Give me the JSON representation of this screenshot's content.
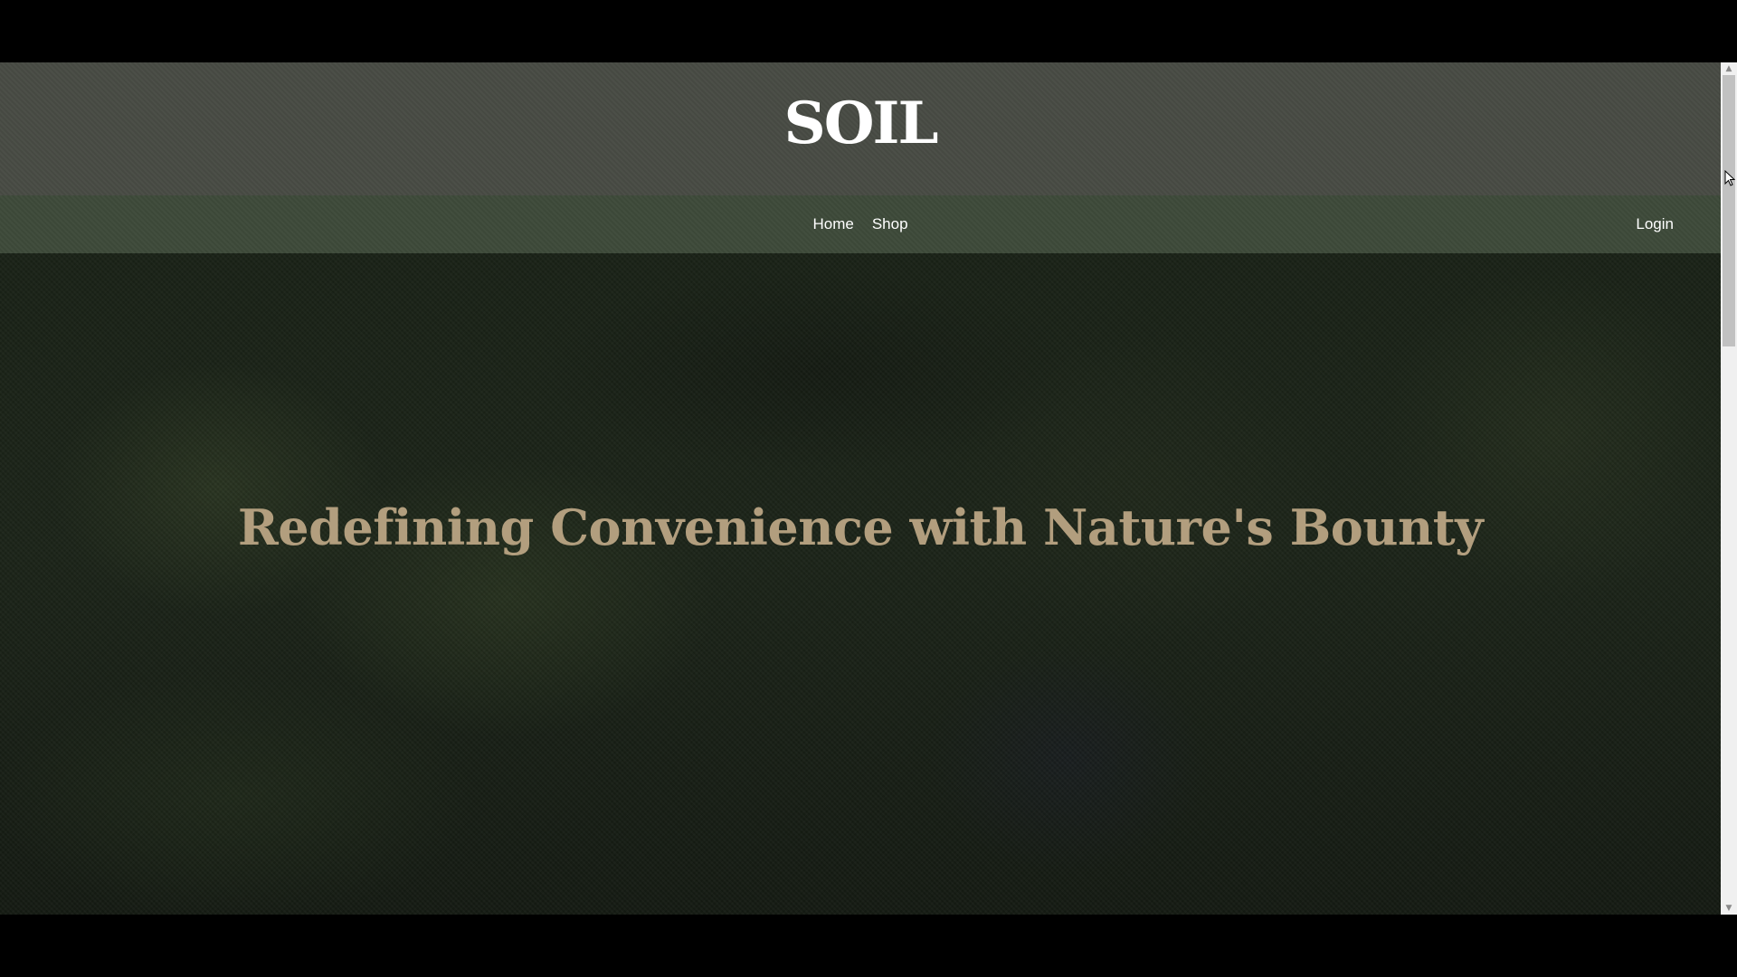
{
  "brand": {
    "title": "SOIL"
  },
  "nav": {
    "links": [
      {
        "label": "Home"
      },
      {
        "label": "Shop"
      }
    ],
    "login_label": "Login"
  },
  "hero": {
    "headline": "Redefining Convenience with Nature's Bounty"
  },
  "scrollbar": {
    "up_icon": "chevron-up-icon",
    "down_icon": "chevron-down-icon"
  },
  "colors": {
    "brand_header_bg": "#484b44",
    "navbar_bg": "#3e4a3a",
    "hero_bg": "#1a2217",
    "headline_color": "#b29e7e",
    "text_white": "#ffffff"
  }
}
